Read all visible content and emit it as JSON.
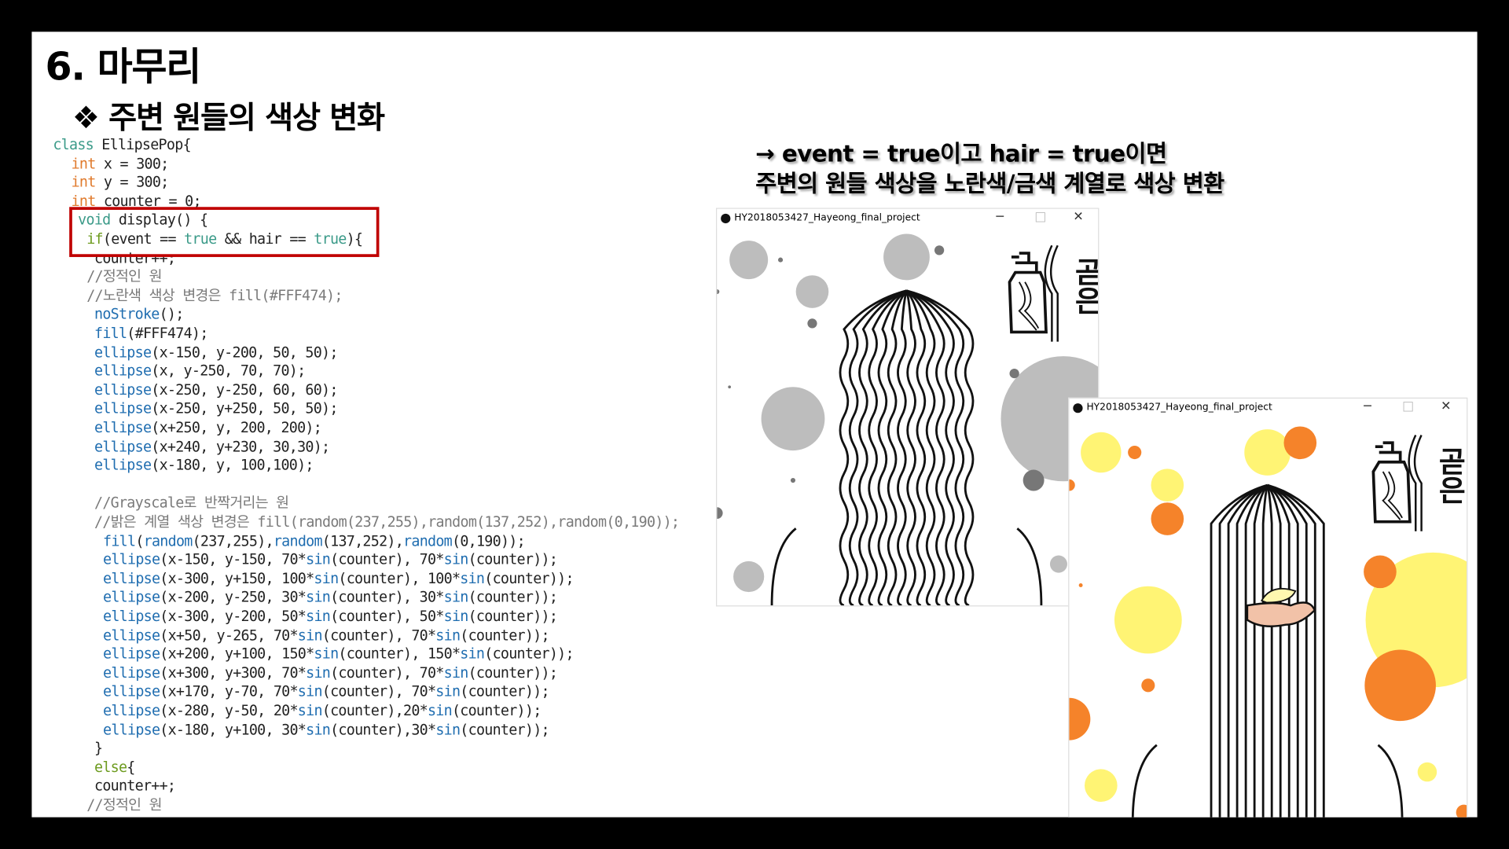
{
  "slide": {
    "title": "6. 마무리",
    "subtitle": "❖ 주변 원들의 색상 변화",
    "note_line1": "→ event = true이고 hair =  true이면",
    "note_line2": "주변의 원들 색상을 노란색/금색 계열로 색상 변환"
  },
  "code_lines": [
    [
      [
        "class",
        "kw"
      ],
      [
        " EllipsePop{",
        ""
      ]
    ],
    [
      [
        "int",
        "int"
      ],
      [
        " x = 300;",
        ""
      ]
    ],
    [
      [
        "int",
        "int"
      ],
      [
        " y = 300;",
        ""
      ]
    ],
    [
      [
        "int",
        "int"
      ],
      [
        " counter = 0;",
        ""
      ]
    ],
    [
      [
        "void",
        "kw"
      ],
      [
        " display() {",
        ""
      ]
    ],
    [
      [
        "if",
        "if"
      ],
      [
        "(event == ",
        ""
      ],
      [
        "true",
        "kw"
      ],
      [
        " && hair == ",
        ""
      ],
      [
        "true",
        "kw"
      ],
      [
        "){",
        ""
      ]
    ],
    [
      [
        "counter++;",
        ""
      ]
    ],
    [
      [
        "//정적인 원",
        "cm"
      ]
    ],
    [
      [
        "//노란색 색상 변경은 fill(#FFF474);",
        "cm"
      ]
    ],
    [
      [
        "noStroke",
        "fn"
      ],
      [
        "();",
        ""
      ]
    ],
    [
      [
        "fill",
        "fn"
      ],
      [
        "(#FFF474);",
        ""
      ]
    ],
    [
      [
        "ellipse",
        "fn"
      ],
      [
        "(x-150, y-200, 50, 50);",
        ""
      ]
    ],
    [
      [
        "ellipse",
        "fn"
      ],
      [
        "(x, y-250, 70, 70);",
        ""
      ]
    ],
    [
      [
        "ellipse",
        "fn"
      ],
      [
        "(x-250, y-250, 60, 60);",
        ""
      ]
    ],
    [
      [
        "ellipse",
        "fn"
      ],
      [
        "(x-250, y+250, 50, 50);",
        ""
      ]
    ],
    [
      [
        "ellipse",
        "fn"
      ],
      [
        "(x+250, y, 200, 200);",
        ""
      ]
    ],
    [
      [
        "ellipse",
        "fn"
      ],
      [
        "(x+240, y+230, 30,30);",
        ""
      ]
    ],
    [
      [
        "ellipse",
        "fn"
      ],
      [
        "(x-180, y, 100,100);",
        ""
      ]
    ],
    [],
    [
      [
        "//Grayscale로 반짝거리는 원",
        "cm"
      ]
    ],
    [
      [
        "//밝은 계열 색상 변경은 fill(random(237,255),random(137,252),random(0,190));",
        "cm"
      ]
    ],
    [
      [
        "fill",
        "fn"
      ],
      [
        "(",
        ""
      ],
      [
        "random",
        "fn"
      ],
      [
        "(237,255),",
        ""
      ],
      [
        "random",
        "fn"
      ],
      [
        "(137,252),",
        ""
      ],
      [
        "random",
        "fn"
      ],
      [
        "(0,190));",
        ""
      ]
    ],
    [
      [
        "ellipse",
        "fn"
      ],
      [
        "(x-150, y-150, 70*",
        ""
      ],
      [
        "sin",
        "fn"
      ],
      [
        "(counter), 70*",
        ""
      ],
      [
        "sin",
        "fn"
      ],
      [
        "(counter));",
        ""
      ]
    ],
    [
      [
        "ellipse",
        "fn"
      ],
      [
        "(x-300, y+150, 100*",
        ""
      ],
      [
        "sin",
        "fn"
      ],
      [
        "(counter), 100*",
        ""
      ],
      [
        "sin",
        "fn"
      ],
      [
        "(counter));",
        ""
      ]
    ],
    [
      [
        "ellipse",
        "fn"
      ],
      [
        "(x-200, y-250, 30*",
        ""
      ],
      [
        "sin",
        "fn"
      ],
      [
        "(counter), 30*",
        ""
      ],
      [
        "sin",
        "fn"
      ],
      [
        "(counter));",
        ""
      ]
    ],
    [
      [
        "ellipse",
        "fn"
      ],
      [
        "(x-300, y-200, 50*",
        ""
      ],
      [
        "sin",
        "fn"
      ],
      [
        "(counter), 50*",
        ""
      ],
      [
        "sin",
        "fn"
      ],
      [
        "(counter));",
        ""
      ]
    ],
    [
      [
        "ellipse",
        "fn"
      ],
      [
        "(x+50, y-265, 70*",
        ""
      ],
      [
        "sin",
        "fn"
      ],
      [
        "(counter), 70*",
        ""
      ],
      [
        "sin",
        "fn"
      ],
      [
        "(counter));",
        ""
      ]
    ],
    [
      [
        "ellipse",
        "fn"
      ],
      [
        "(x+200, y+100, 150*",
        ""
      ],
      [
        "sin",
        "fn"
      ],
      [
        "(counter), 150*",
        ""
      ],
      [
        "sin",
        "fn"
      ],
      [
        "(counter));",
        ""
      ]
    ],
    [
      [
        "ellipse",
        "fn"
      ],
      [
        "(x+300, y+300, 70*",
        ""
      ],
      [
        "sin",
        "fn"
      ],
      [
        "(counter), 70*",
        ""
      ],
      [
        "sin",
        "fn"
      ],
      [
        "(counter));",
        ""
      ]
    ],
    [
      [
        "ellipse",
        "fn"
      ],
      [
        "(x+170, y-70, 70*",
        ""
      ],
      [
        "sin",
        "fn"
      ],
      [
        "(counter), 70*",
        ""
      ],
      [
        "sin",
        "fn"
      ],
      [
        "(counter));",
        ""
      ]
    ],
    [
      [
        "ellipse",
        "fn"
      ],
      [
        "(x-280, y-50, 20*",
        ""
      ],
      [
        "sin",
        "fn"
      ],
      [
        "(counter),20*",
        ""
      ],
      [
        "sin",
        "fn"
      ],
      [
        "(counter));",
        ""
      ]
    ],
    [
      [
        "ellipse",
        "fn"
      ],
      [
        "(x-180, y+100, 30*",
        ""
      ],
      [
        "sin",
        "fn"
      ],
      [
        "(counter),30*",
        ""
      ],
      [
        "sin",
        "fn"
      ],
      [
        "(counter));",
        ""
      ]
    ],
    [
      [
        "}",
        ""
      ]
    ],
    [
      [
        "else",
        "if"
      ],
      [
        "{",
        ""
      ]
    ],
    [
      [
        "counter++;",
        ""
      ]
    ],
    [
      [
        "//정적인 원",
        "cm"
      ]
    ]
  ],
  "windows": [
    {
      "title": "HY2018053427_Hayeong_final_project",
      "minimize": "─",
      "maximize": "□",
      "close": "✕",
      "logo_text": "곧은"
    },
    {
      "title": "HY2018053427_Hayeong_final_project",
      "minimize": "─",
      "maximize": "□",
      "close": "✕",
      "logo_text": "곧은"
    }
  ],
  "colors": {
    "highlight_box": "#c00000",
    "gray_circle": "#bdbdbd",
    "yellow_circle": "#fff474",
    "orange_circle": "#f5832a"
  }
}
